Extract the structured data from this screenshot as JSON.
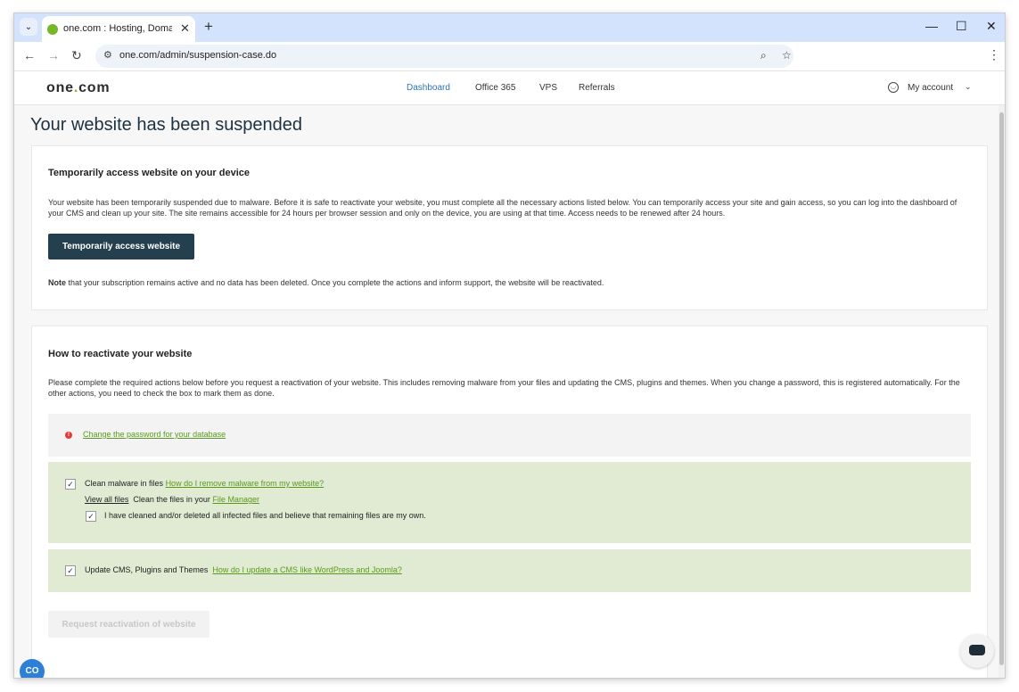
{
  "browser": {
    "tab_title": "one.com : Hosting, Domain, Em",
    "tab_close": "✕",
    "new_tab": "+",
    "url": "one.com/admin/suspension-case.do",
    "window_controls": [
      "—",
      "☐",
      "✕"
    ]
  },
  "site": {
    "logo_prefix": "one",
    "logo_dot": ".",
    "logo_suffix": "com",
    "nav": [
      "Dashboard",
      "Office 365",
      "VPS",
      "Referrals"
    ],
    "account_label": "My account"
  },
  "page_title": "Your website has been suspended",
  "temp_access": {
    "heading": "Temporarily access website on your device",
    "body": "Your website has been temporarily suspended due to malware. Before it is safe to reactivate your website, you must complete all the necessary actions listed below. You can temporarily access your site and gain access, so you can log into the dashboard of your CMS and clean up your site. The site remains accessible for 24 hours per browser session and only on the device, you are using at that time. Access needs to be renewed after 24 hours.",
    "button_label": "Temporarily access website",
    "note_bold": "Note",
    "note_text": " that your subscription remains active and no data has been deleted. Once you complete the actions and inform support, the website will be reactivated."
  },
  "reactivate": {
    "heading": "How to reactivate your website",
    "body": "Please complete the required actions below before you request a reactivation of your website. This includes removing malware from your files and updating the CMS, plugins and themes. When you change a password, this is registered automatically. For the other actions, you need to check the box to mark them as done.",
    "task_password_link": "Change the password for your database",
    "task_malware_label": "Clean malware in files",
    "task_malware_help": "How do I remove malware from my website?",
    "view_all_files": "View all files",
    "clean_files_text": "Clean the files in your",
    "file_manager_link": "File Manager",
    "confirm_clean_text": "I have cleaned and/or deleted all infected files and believe that remaining files are my own.",
    "task_cms_label": "Update CMS, Plugins and Themes",
    "task_cms_help": "How do I update a CMS like WordPress and Joomla?",
    "request_button": "Request reactivation of website",
    "checkbox_states": {
      "malware": true,
      "confirm_clean": true,
      "cms": true
    }
  },
  "colors": {
    "brand_green": "#76b82a",
    "primary_button": "#24404f",
    "done_bg": "#e1ebd4",
    "link_green": "#5a9a1a"
  }
}
